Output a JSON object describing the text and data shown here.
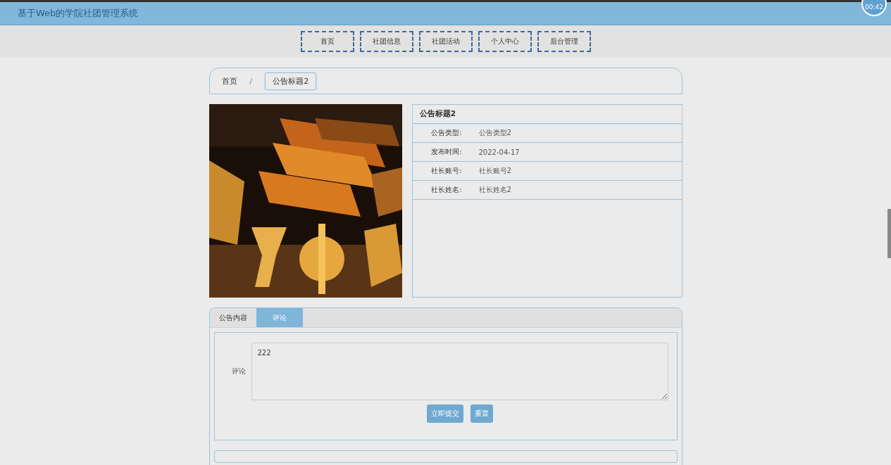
{
  "header": {
    "title": "基于Web的学院社团管理系统",
    "timer": "00:42"
  },
  "nav": [
    {
      "label": "首页"
    },
    {
      "label": "社团信息"
    },
    {
      "label": "社团活动"
    },
    {
      "label": "个人中心"
    },
    {
      "label": "后台管理"
    }
  ],
  "breadcrumb_separator": "/",
  "breadcrumb": [
    {
      "label": "首页",
      "selected": false
    },
    {
      "label": "公告标题2",
      "selected": true
    }
  ],
  "detail": {
    "title": "公告标题2",
    "fields": [
      {
        "label": "公告类型:",
        "value": "公告类型2"
      },
      {
        "label": "发布时间:",
        "value": "2022-04-17"
      },
      {
        "label": "社长账号:",
        "value": "社长账号2"
      },
      {
        "label": "社长姓名:",
        "value": "社长姓名2"
      }
    ]
  },
  "tabs": [
    {
      "label": "公告内容",
      "selected": false
    },
    {
      "label": "评论",
      "selected": true
    }
  ],
  "comment_form": {
    "label": "评论",
    "value": "222",
    "buttons": [
      "立即提交",
      "重置"
    ]
  }
}
